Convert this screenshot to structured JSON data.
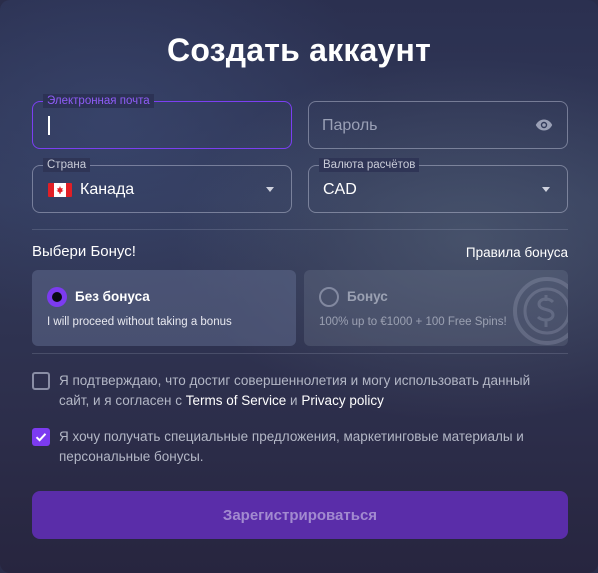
{
  "title": "Создать аккаунт",
  "email": {
    "label": "Электронная почта",
    "value": ""
  },
  "password": {
    "placeholder": "Пароль"
  },
  "country": {
    "label": "Страна",
    "value": "Канада"
  },
  "currency": {
    "label": "Валюта расчётов",
    "value": "CAD"
  },
  "bonus": {
    "heading": "Выбери Бонус!",
    "rules_link": "Правила бонуса",
    "options": [
      {
        "name": "Без бонуса",
        "description": "I will proceed without taking a bonus",
        "selected": true
      },
      {
        "name": "Бонус",
        "description": "100% up to €1000 + 100 Free Spins!",
        "selected": false
      }
    ]
  },
  "consents": {
    "age": {
      "text_before": "Я подтверждаю, что достиг совершеннолетия и могу использовать данный сайт, и я согласен с ",
      "terms_link": "Terms of Service",
      "and": " и ",
      "privacy_link": "Privacy policy",
      "checked": false
    },
    "marketing": {
      "text": "Я хочу получать специальные предложения, маркетинговые материалы и персональные бонусы.",
      "checked": true
    }
  },
  "submit_label": "Зарегистрироваться",
  "colors": {
    "accent": "#7c3bf0",
    "button": "#5a2da9"
  },
  "icons": [
    "eye-icon",
    "caret-down-icon",
    "canada-flag-icon",
    "radio-icon",
    "coin-icon",
    "check-mark-icon"
  ]
}
